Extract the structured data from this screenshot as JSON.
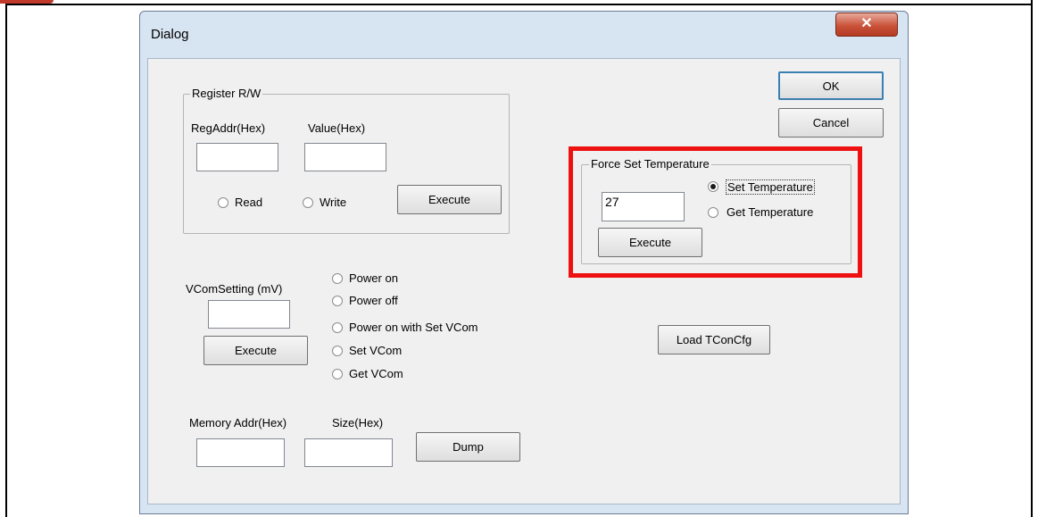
{
  "dialog": {
    "title": "Dialog",
    "close_icon": "close-x-icon",
    "ok_label": "OK",
    "cancel_label": "Cancel"
  },
  "register_rw": {
    "legend": "Register R/W",
    "reg_addr_label": "RegAddr(Hex)",
    "value_label": "Value(Hex)",
    "reg_addr_value": "",
    "value_value": "",
    "read_label": "Read",
    "write_label": "Write",
    "execute_label": "Execute"
  },
  "force_temp": {
    "legend": "Force Set Temperature",
    "temperature_value": "27",
    "set_label": "Set Temperature",
    "get_label": "Get Temperature",
    "selected": "Set Temperature",
    "execute_label": "Execute"
  },
  "vcom": {
    "label": "VComSetting (mV)",
    "value": "",
    "execute_label": "Execute",
    "options": [
      "Power on",
      "Power off",
      "Power on with Set VCom",
      "Set VCom",
      "Get VCom"
    ]
  },
  "load_tcon_label": "Load TConCfg",
  "memory": {
    "addr_label": "Memory Addr(Hex)",
    "size_label": "Size(Hex)",
    "addr_value": "",
    "size_value": "",
    "dump_label": "Dump"
  },
  "colors": {
    "highlight": "#ee1111",
    "window_frame": "#d7e4f2",
    "client_bg": "#f0f0f0"
  }
}
